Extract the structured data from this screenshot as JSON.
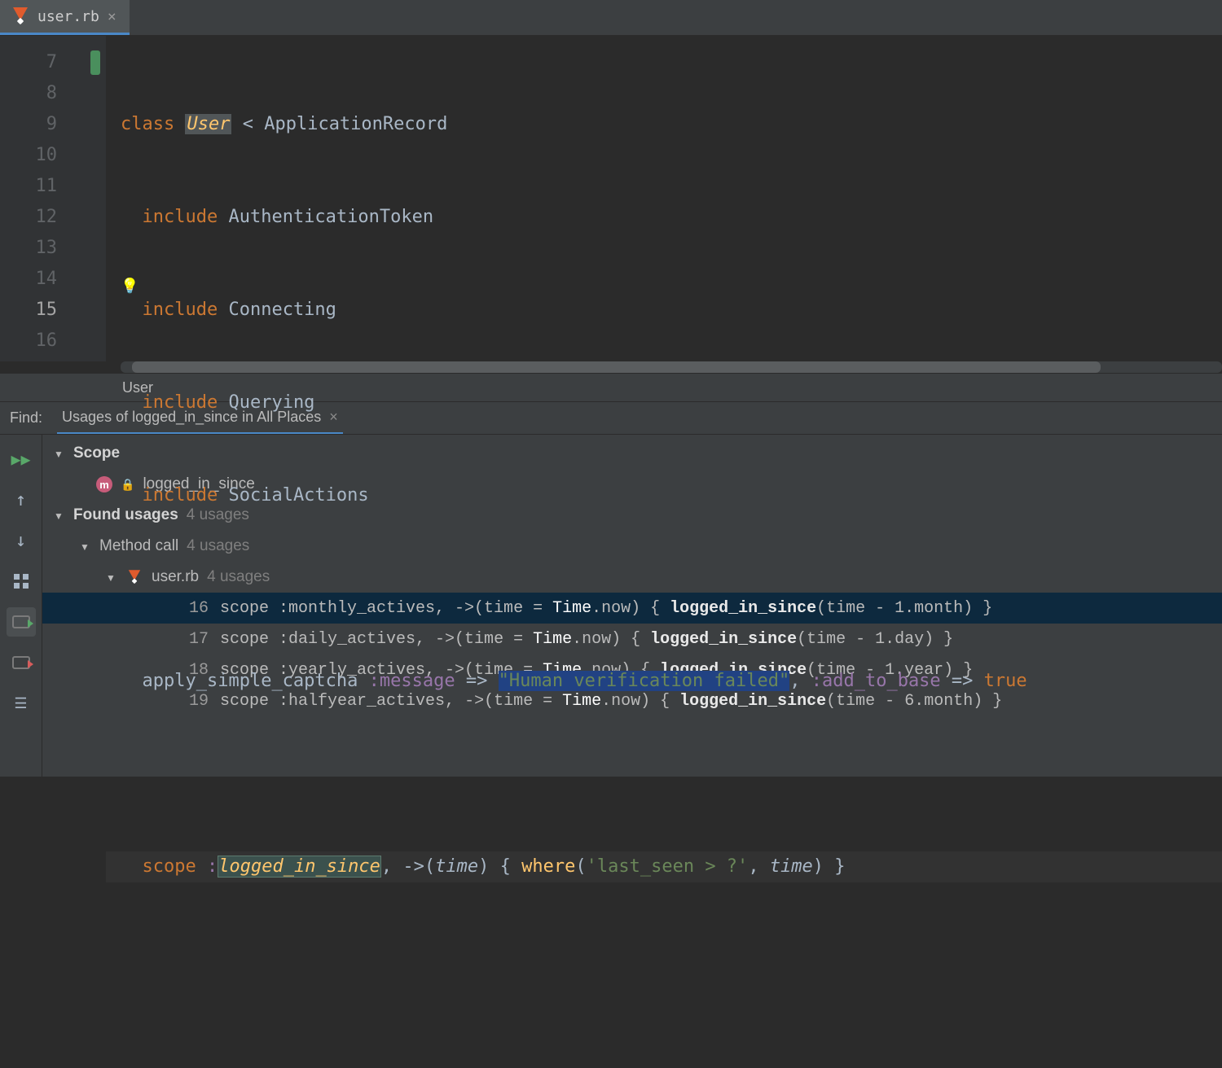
{
  "tab": {
    "filename": "user.rb"
  },
  "editor": {
    "lines": [
      7,
      8,
      9,
      10,
      11,
      12,
      13,
      14,
      15,
      16
    ],
    "current_line": 15,
    "class_decl": {
      "kw": "class",
      "name": "User",
      "lt": " < ",
      "parent": "ApplicationRecord"
    },
    "includes_kw": "include",
    "includes": [
      "AuthenticationToken",
      "Connecting",
      "Querying",
      "SocialActions"
    ],
    "captcha": {
      "method": "apply_simple_captcha",
      "msg_key": ":message",
      "arrow": " => ",
      "msg_val": "\"Human verification failed\"",
      "atk_key": ":add_to_base",
      "true": "true"
    },
    "scope": {
      "kw": "scope",
      "name": "logged_in_since",
      "arrow": "->",
      "param": "time",
      "where_kw": "where",
      "where_arg": "'last_seen > ?'",
      "body_suffix": ") }"
    }
  },
  "breadcrumb": "User",
  "find": {
    "label": "Find:",
    "tab_title": "Usages of logged_in_since in All Places",
    "tree": {
      "scope_label": "Scope",
      "scope_value": "logged_in_since",
      "found_label": "Found usages",
      "found_count": "4 usages",
      "method_call_label": "Method call",
      "method_call_count": "4 usages",
      "file_label": "user.rb",
      "file_count": "4 usages"
    },
    "usages": [
      {
        "ln": 16,
        "scope_name": ":monthly_actives",
        "time_default": "Time",
        "now": ".now",
        "call": "logged_in_since",
        "arg_suffix": "(time - 1.month) }"
      },
      {
        "ln": 17,
        "scope_name": ":daily_actives",
        "time_default": "Time",
        "now": ".now",
        "call": "logged_in_since",
        "arg_suffix": "(time - 1.day) }"
      },
      {
        "ln": 18,
        "scope_name": ":yearly_actives",
        "time_default": "Time",
        "now": ".now",
        "call": "logged_in_since",
        "arg_suffix": "(time - 1.year) }"
      },
      {
        "ln": 19,
        "scope_name": ":halfyear_actives",
        "time_default": "Time",
        "now": ".now",
        "call": "logged_in_since",
        "arg_suffix": "(time - 6.month) }"
      }
    ],
    "usage_prefix": "scope ",
    "usage_arrow": ", ->(time = ",
    "usage_brace": ") { "
  }
}
